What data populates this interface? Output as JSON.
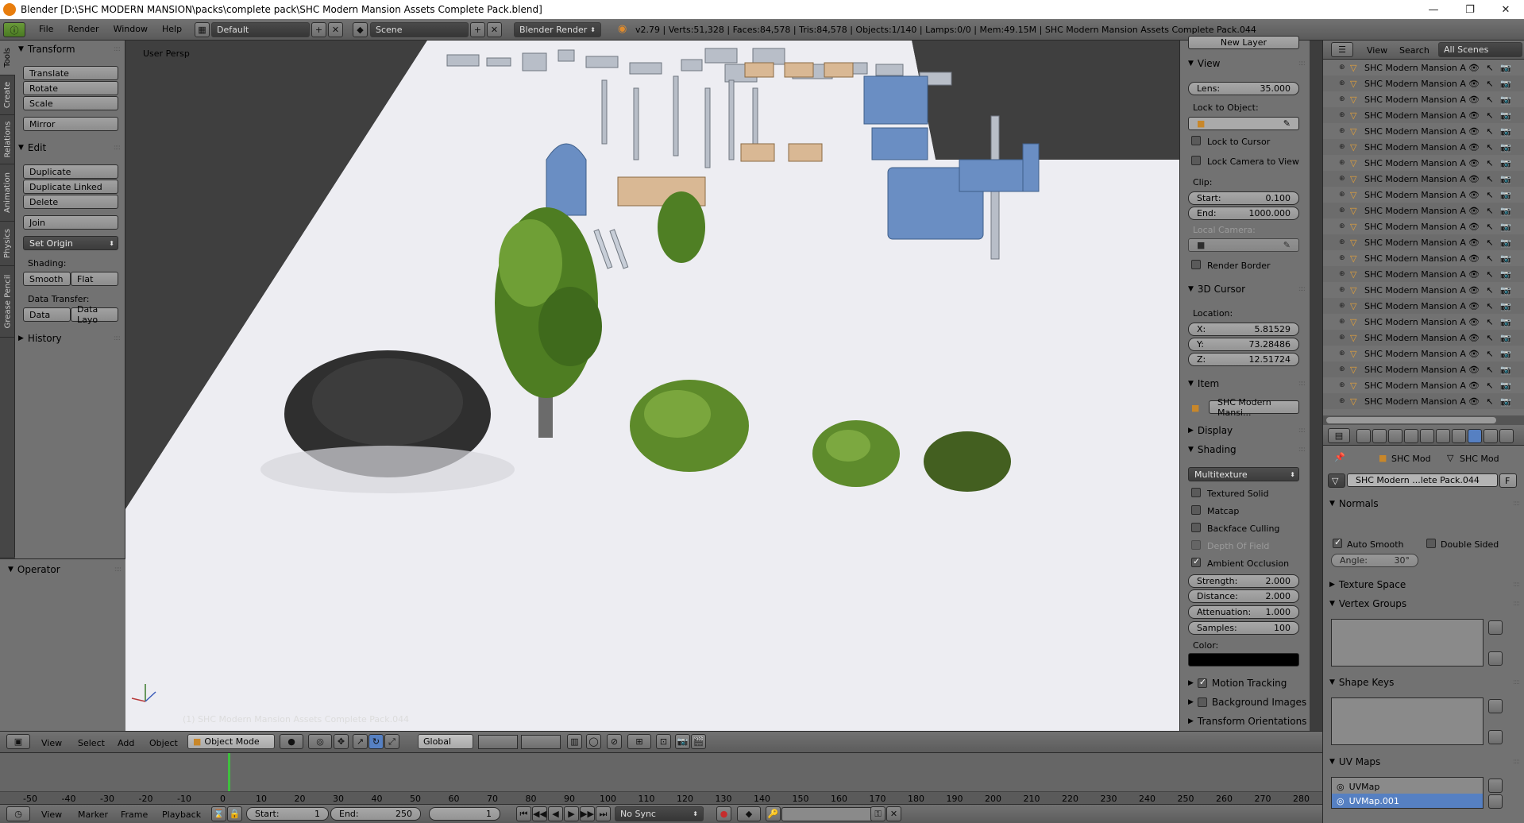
{
  "window": {
    "title": "Blender [D:\\SHC MODERN MANSION\\packs\\complete pack\\SHC Modern Mansion Assets Complete Pack.blend]",
    "minimize": "—",
    "maximize": "❐",
    "close": "✕"
  },
  "info_header": {
    "menus": [
      "File",
      "Render",
      "Window",
      "Help"
    ],
    "layout": "Default",
    "scene": "Scene",
    "engine": "Blender Render",
    "stats": "v2.79 | Verts:51,328 | Faces:84,578 | Tris:84,578 | Objects:1/140 | Lamps:0/0 | Mem:49.15M | SHC Modern Mansion Assets Complete Pack.044"
  },
  "vertical_tabs": [
    "Tools",
    "Create",
    "Relations",
    "Animation",
    "Physics",
    "Grease Pencil"
  ],
  "toolshelf": {
    "transform": {
      "title": "Transform",
      "buttons": [
        "Translate",
        "Rotate",
        "Scale",
        "Mirror"
      ]
    },
    "edit": {
      "title": "Edit",
      "buttons": [
        "Duplicate",
        "Duplicate Linked",
        "Delete",
        "Join"
      ],
      "set_origin": "Set Origin",
      "shading_label": "Shading:",
      "smooth": "Smooth",
      "flat": "Flat",
      "data_transfer_label": "Data Transfer:",
      "data": "Data",
      "data_layout": "Data Layo"
    },
    "history": "History",
    "operator": "Operator"
  },
  "viewport": {
    "view_name": "User Persp",
    "object_label": "(1) SHC Modern Mansion Assets Complete Pack.044"
  },
  "npanel": {
    "new_layer": "New Layer",
    "view": {
      "title": "View",
      "lens_label": "Lens:",
      "lens_value": "35.000",
      "lock_to_object": "Lock to Object:",
      "lock_to_cursor": "Lock to Cursor",
      "lock_camera": "Lock Camera to View",
      "clip": "Clip:",
      "start_label": "Start:",
      "start_value": "0.100",
      "end_label": "End:",
      "end_value": "1000.000",
      "local_camera": "Local Camera:",
      "render_border": "Render Border"
    },
    "cursor": {
      "title": "3D Cursor",
      "location": "Location:",
      "x_label": "X:",
      "x_value": "5.81529",
      "y_label": "Y:",
      "y_value": "73.28486",
      "z_label": "Z:",
      "z_value": "12.51724"
    },
    "item": {
      "title": "Item",
      "name": "SHC Modern Mansi..."
    },
    "display": "Display",
    "shading": {
      "title": "Shading",
      "mode": "Multitexture",
      "textured_solid": "Textured Solid",
      "matcap": "Matcap",
      "backface": "Backface Culling",
      "dof": "Depth Of Field",
      "ao": "Ambient Occlusion",
      "strength_label": "Strength:",
      "strength_value": "2.000",
      "distance_label": "Distance:",
      "distance_value": "2.000",
      "attenuation_label": "Attenuation:",
      "attenuation_value": "1.000",
      "samples_label": "Samples:",
      "samples_value": "100",
      "color_label": "Color:"
    },
    "motion_tracking": "Motion Tracking",
    "background_images": "Background Images",
    "transform_orientations": "Transform Orientations"
  },
  "outliner": {
    "view": "View",
    "search": "Search",
    "filter": "All Scenes",
    "row_label": "SHC Modern Mansion A",
    "rows": [
      "SHC Modern Mansion A",
      "SHC Modern Mansion A",
      "SHC Modern Mansion A",
      "SHC Modern Mansion A",
      "SHC Modern Mansion A",
      "SHC Modern Mansion A",
      "SHC Modern Mansion A",
      "SHC Modern Mansion A",
      "SHC Modern Mansion A",
      "SHC Modern Mansion A",
      "SHC Modern Mansion A",
      "SHC Modern Mansion A",
      "SHC Modern Mansion A",
      "SHC Modern Mansion A",
      "SHC Modern Mansion A",
      "SHC Modern Mansion A",
      "SHC Modern Mansion A",
      "SHC Modern Mansion A",
      "SHC Modern Mansion A",
      "SHC Modern Mansion A",
      "SHC Modern Mansion A",
      "SHC Modern Mansion A",
      "SHC Modern Mansion A"
    ]
  },
  "properties": {
    "breadcrumb_obj": "SHC Mod",
    "breadcrumb_data": "SHC Mod",
    "mesh_name": "SHC Modern ...lete Pack.044",
    "fake_user": "F",
    "normals": "Normals",
    "auto_smooth": "Auto Smooth",
    "double_sided": "Double Sided",
    "angle_label": "Angle:",
    "angle_value": "30°",
    "texture_space": "Texture Space",
    "vertex_groups": "Vertex Groups",
    "shape_keys": "Shape Keys",
    "uv_maps": "UV Maps",
    "uvmap1": "UVMap",
    "uvmap2": "UVMap.001"
  },
  "view3d_header": {
    "view": "View",
    "select": "Select",
    "add": "Add",
    "object": "Object",
    "mode": "Object Mode",
    "orientation": "Global"
  },
  "timeline": {
    "ticks": [
      "-50",
      "-40",
      "-30",
      "-20",
      "-10",
      "0",
      "10",
      "20",
      "30",
      "40",
      "50",
      "60",
      "70",
      "80",
      "90",
      "100",
      "110",
      "120",
      "130",
      "140",
      "150",
      "160",
      "170",
      "180",
      "190",
      "200",
      "210",
      "220",
      "230",
      "240",
      "250",
      "260",
      "270",
      "280"
    ],
    "view": "View",
    "marker": "Marker",
    "frame": "Frame",
    "playback": "Playback",
    "start_label": "Start:",
    "start_value": "1",
    "end_label": "End:",
    "end_value": "250",
    "current": "1",
    "sync": "No Sync"
  },
  "colors": {
    "accent": "#5680c2",
    "selected_row": "#5680c2",
    "frame_cursor": "#3fbf3f",
    "tree_green": "#5d8a2a"
  }
}
